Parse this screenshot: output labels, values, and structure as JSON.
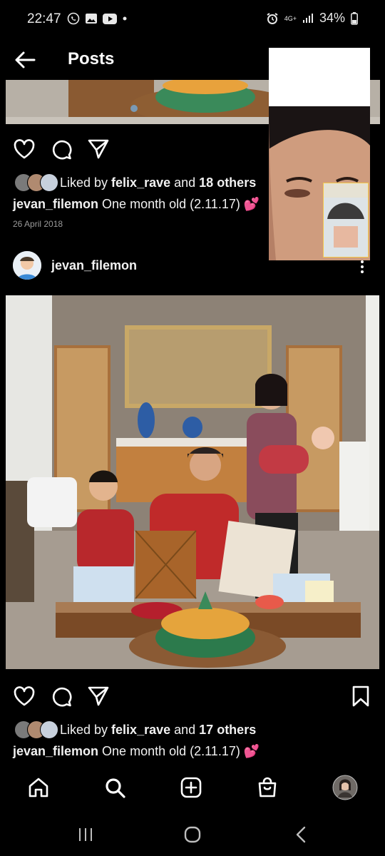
{
  "status_bar": {
    "time": "22:47",
    "network": "4G+",
    "battery": "34%"
  },
  "header": {
    "title": "Posts"
  },
  "post1": {
    "liked_prefix": "Liked by ",
    "liked_user": "felix_rave",
    "liked_and": " and ",
    "liked_count": "18 others",
    "caption_user": "jevan_filemon",
    "caption_text": " One month old (2.11.17) 💕",
    "date": "26 April 2018"
  },
  "post2": {
    "username": "jevan_filemon",
    "liked_prefix": "Liked by ",
    "liked_user": "felix_rave",
    "liked_and": " and ",
    "liked_count": "17 others",
    "caption_user": "jevan_filemon",
    "caption_text": " One month old (2.11.17) 💕"
  },
  "icons": {
    "like": "heart-icon",
    "comment": "comment-icon",
    "share": "send-icon",
    "save": "bookmark-icon",
    "home": "home-icon",
    "search": "search-icon",
    "create": "add-post-icon",
    "shop": "shop-icon",
    "profile": "profile-avatar"
  },
  "colors": {
    "background": "#000000",
    "text": "#f1f1f1",
    "muted": "#9a9a9a"
  }
}
